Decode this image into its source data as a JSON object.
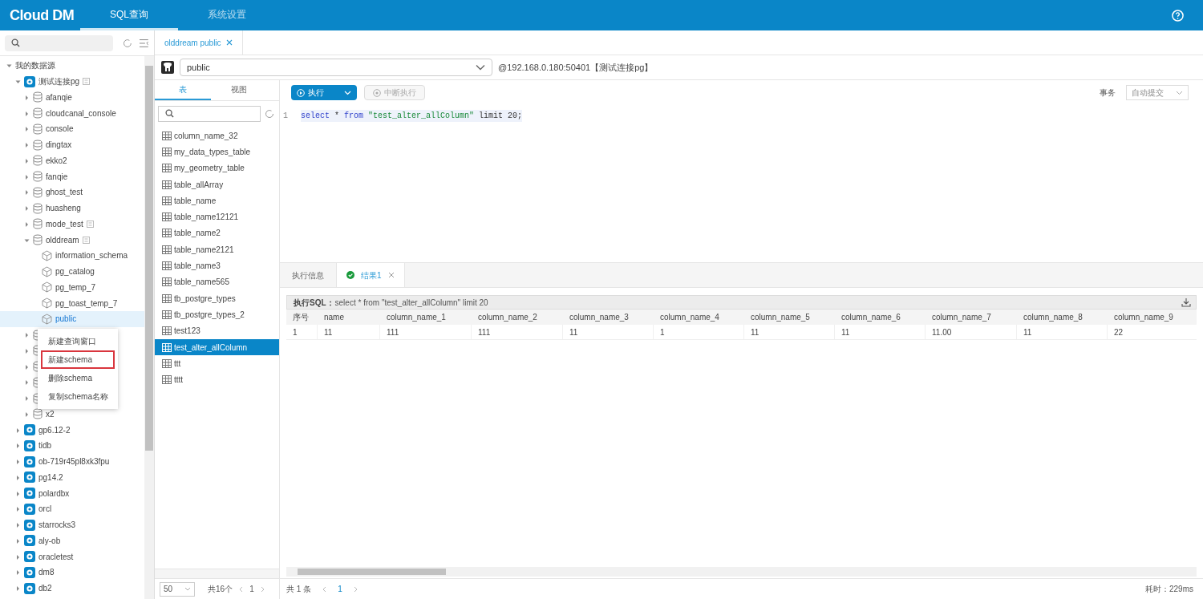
{
  "header": {
    "logo": "Cloud DM",
    "tabs": [
      {
        "label": "SQL查询",
        "selected": true
      },
      {
        "label": "系统设置",
        "selected": false
      }
    ]
  },
  "sidebar": {
    "tree": [
      {
        "name": "我的数据源",
        "expanded": true,
        "children": [
          {
            "name": "测试连接pg",
            "kind": "datasource",
            "expanded": true,
            "badge": true,
            "children": [
              {
                "name": "afanqie",
                "kind": "database",
                "expanded": false
              },
              {
                "name": "cloudcanal_console",
                "kind": "database",
                "expanded": false
              },
              {
                "name": "console",
                "kind": "database",
                "expanded": false
              },
              {
                "name": "dingtax",
                "kind": "database",
                "expanded": false
              },
              {
                "name": "ekko2",
                "kind": "database",
                "expanded": false
              },
              {
                "name": "fanqie",
                "kind": "database",
                "expanded": false
              },
              {
                "name": "ghost_test",
                "kind": "database",
                "expanded": false
              },
              {
                "name": "huasheng",
                "kind": "database",
                "expanded": false
              },
              {
                "name": "mode_test",
                "kind": "database",
                "expanded": false,
                "badge": true
              },
              {
                "name": "olddream",
                "kind": "database",
                "expanded": true,
                "badge": true,
                "children": [
                  {
                    "name": "information_schema",
                    "kind": "schema",
                    "selected": false
                  },
                  {
                    "name": "pg_catalog",
                    "kind": "schema",
                    "selected": false
                  },
                  {
                    "name": "pg_temp_7",
                    "kind": "schema",
                    "selected": false
                  },
                  {
                    "name": "pg_toast_temp_7",
                    "kind": "schema",
                    "selected": false
                  },
                  {
                    "name": "public",
                    "kind": "schema",
                    "selected": true
                  }
                ]
              },
              {
                "kind": "database",
                "expanded": false
              },
              {
                "kind": "database",
                "expanded": false
              },
              {
                "kind": "database",
                "expanded": false
              },
              {
                "kind": "database",
                "expanded": false
              },
              {
                "kind": "database",
                "expanded": false
              },
              {
                "name": "x2",
                "kind": "database",
                "expanded": false
              }
            ]
          },
          {
            "name": "gp6.12-2",
            "kind": "datasource",
            "expanded": false
          },
          {
            "name": "tidb",
            "kind": "datasource",
            "expanded": false
          },
          {
            "name": "ob-719r45pl8xk3fpu",
            "kind": "datasource",
            "expanded": false
          },
          {
            "name": "pg14.2",
            "kind": "datasource",
            "expanded": false
          },
          {
            "name": "polardbx",
            "kind": "datasource",
            "expanded": false
          },
          {
            "name": "orcl",
            "kind": "datasource",
            "expanded": false
          },
          {
            "name": "starrocks3",
            "kind": "datasource",
            "expanded": false
          },
          {
            "name": "aly-ob",
            "kind": "datasource",
            "expanded": false
          },
          {
            "name": "oracletest",
            "kind": "datasource",
            "expanded": false
          },
          {
            "name": "dm8",
            "kind": "datasource",
            "expanded": false
          },
          {
            "name": "db2",
            "kind": "datasource",
            "expanded": false
          }
        ]
      }
    ]
  },
  "context_menu": [
    {
      "label": "新建查询窗口",
      "highlighted": false
    },
    {
      "label": "新建schema",
      "highlighted": true
    },
    {
      "label": "删除schema",
      "highlighted": false
    },
    {
      "label": "复制schema名称",
      "highlighted": false
    }
  ],
  "editor_tabs": [
    {
      "label": "olddream public",
      "selected": true
    }
  ],
  "schema_select": {
    "value": "public"
  },
  "connection": "@192.168.0.180:50401【测试连接pg】",
  "object_tabs": [
    {
      "label": "表",
      "selected": true
    },
    {
      "label": "视图",
      "selected": false
    }
  ],
  "tables": [
    {
      "name": "column_name_32",
      "selected": false
    },
    {
      "name": "my_data_types_table",
      "selected": false
    },
    {
      "name": "my_geometry_table",
      "selected": false
    },
    {
      "name": "table_allArray",
      "selected": false
    },
    {
      "name": "table_name",
      "selected": false
    },
    {
      "name": "table_name12121",
      "selected": false
    },
    {
      "name": "table_name2",
      "selected": false
    },
    {
      "name": "table_name2121",
      "selected": false
    },
    {
      "name": "table_name3",
      "selected": false
    },
    {
      "name": "table_name565",
      "selected": false
    },
    {
      "name": "tb_postgre_types",
      "selected": false
    },
    {
      "name": "tb_postgre_types_2",
      "selected": false
    },
    {
      "name": "test123",
      "selected": false
    },
    {
      "name": "test_alter_allColumn",
      "selected": true
    },
    {
      "name": "ttt",
      "selected": false
    },
    {
      "name": "tttt",
      "selected": false
    }
  ],
  "table_pager": {
    "page_size": "50",
    "total": "共16个",
    "page": "1"
  },
  "toolbar": {
    "run": "执行",
    "stop": "中断执行",
    "transaction_label": "事务",
    "transaction_mode": "自动提交"
  },
  "code": [
    {
      "line": "1",
      "tokens": [
        {
          "text": "select",
          "kind": "keyword"
        },
        {
          "text": " * ",
          "kind": "plain"
        },
        {
          "text": "from",
          "kind": "keyword"
        },
        {
          "text": " \"test_alter_allColumn\"",
          "kind": "string"
        },
        {
          "text": " limit ",
          "kind": "plain"
        },
        {
          "text": "20",
          "kind": "number"
        },
        {
          "text": ";",
          "kind": "plain"
        }
      ]
    }
  ],
  "result_tabs": [
    {
      "label": "执行信息",
      "selected": false,
      "success": false,
      "closable": false
    },
    {
      "label": "结果1",
      "selected": true,
      "success": true,
      "closable": true
    }
  ],
  "executed_sql": {
    "label": "执行SQL：",
    "sql": "select * from \"test_alter_allColumn\" limit 20"
  },
  "result_table": {
    "columns": [
      "序号",
      "name",
      "column_name_1",
      "column_name_2",
      "column_name_3",
      "column_name_4",
      "column_name_5",
      "column_name_6",
      "column_name_7",
      "column_name_8",
      "column_name_9"
    ],
    "rows": [
      [
        "1",
        "11",
        "111",
        "111",
        "11",
        "1",
        "11",
        "11",
        "11.00",
        "11",
        "22"
      ]
    ]
  },
  "result_footer": {
    "total": "共 1 条",
    "page": "1",
    "elapsed": "耗时：229ms"
  }
}
